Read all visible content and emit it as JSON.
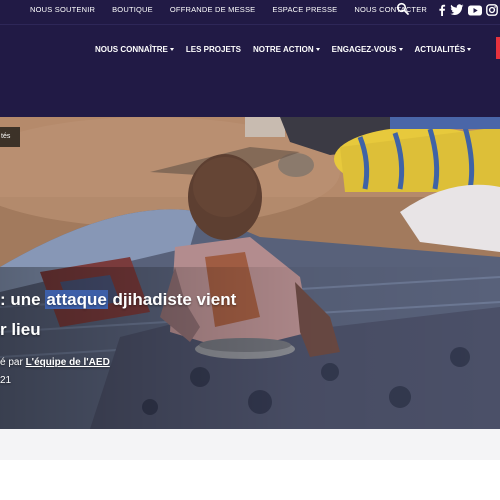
{
  "topbar": {
    "links": [
      "NOUS SOUTENIR",
      "BOUTIQUE",
      "OFFRANDE DE MESSE",
      "ESPACE PRESSE",
      "NOUS CONTACTER"
    ],
    "search_icon": "search-icon",
    "social_icons": [
      "facebook-icon",
      "twitter-icon",
      "youtube-icon",
      "instagram-icon"
    ]
  },
  "nav": {
    "items": [
      {
        "label": "NOUS CONNAÎTRE",
        "dropdown": true
      },
      {
        "label": "LES PROJETS",
        "dropdown": false
      },
      {
        "label": "NOTRE ACTION",
        "dropdown": true
      },
      {
        "label": "ENGAGEZ-VOUS",
        "dropdown": true
      },
      {
        "label": "ACTUALITÉS",
        "dropdown": true
      }
    ]
  },
  "hero": {
    "tag": "tés",
    "title_line1_prefix": ": une ",
    "title_highlight": "attaque",
    "title_line1_suffix": " djihadiste vient",
    "title_line2": "r lieu",
    "byline_prefix": "é par ",
    "author": "L'équipe de l'AED",
    "date": "21"
  },
  "colors": {
    "nav_bg": "#211a45",
    "accent_red": "#e6323d",
    "highlight": "#3d5fa8",
    "band_bg": "#f4f4f6"
  }
}
